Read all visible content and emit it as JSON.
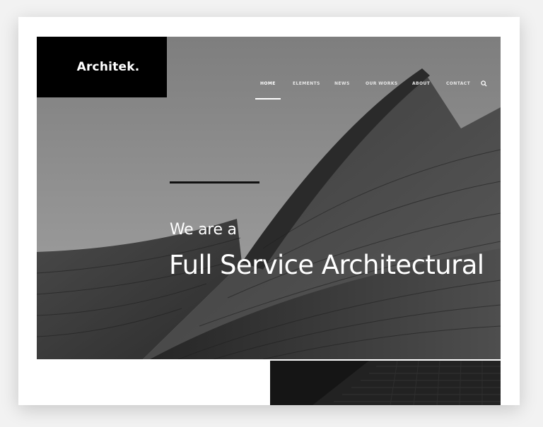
{
  "brand": {
    "logo": "Architek."
  },
  "nav": {
    "items": [
      {
        "label": "HOME",
        "active": true
      },
      {
        "label": "ELEMENTS",
        "active": false
      },
      {
        "label": "NEWS",
        "active": false
      },
      {
        "label": "OUR WORKS",
        "active": false
      },
      {
        "label": "ABOUT",
        "active": false
      },
      {
        "label": "CONTACT",
        "active": false
      }
    ],
    "search_icon": "search-icon"
  },
  "hero": {
    "subtitle": "We are a",
    "title": "Full Service Architectural"
  },
  "colors": {
    "logo_bg": "#000000",
    "accent_line": "#111111",
    "text": "#ffffff"
  }
}
